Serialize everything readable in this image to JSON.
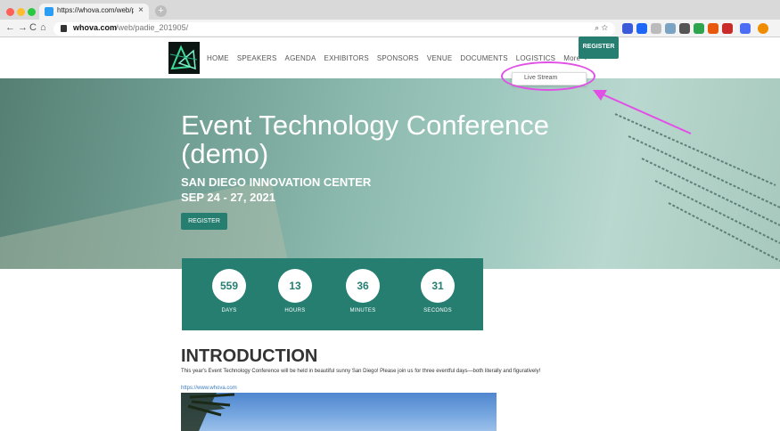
{
  "browser": {
    "tab_title": "https://whova.com/web/padie",
    "tab_close": "×",
    "new_tab": "+",
    "nav_back": "←",
    "nav_forward": "→",
    "nav_reload": "C",
    "nav_home": "⌂",
    "url_host": "whova.com",
    "url_path": "/web/padie_201905/",
    "omni_icons": "⌕ ☆"
  },
  "site": {
    "nav_items": [
      "HOME",
      "SPEAKERS",
      "AGENDA",
      "EXHIBITORS",
      "SPONSORS",
      "VENUE",
      "DOCUMENTS",
      "LOGISTICS"
    ],
    "more_label": "More",
    "register_top": "REGISTER",
    "dropdown_item": "Live Stream"
  },
  "hero": {
    "title": "Event Technology Conference (demo)",
    "venue": "SAN DIEGO INNOVATION CENTER",
    "date": "SEP 24 - 27, 2021",
    "register": "REGISTER"
  },
  "countdown": [
    {
      "value": "559",
      "label": "DAYS"
    },
    {
      "value": "13",
      "label": "HOURS"
    },
    {
      "value": "36",
      "label": "MINUTES"
    },
    {
      "value": "31",
      "label": "SECONDS"
    }
  ],
  "intro": {
    "title": "INTRODUCTION",
    "text": "This year's Event Technology Conference will be held in beautiful sunny San Diego! Please join us for three eventful days—both literally and figuratively!",
    "link": "https://www.whova.com"
  },
  "colors": {
    "accent": "#267e71",
    "annotation": "#e14fe6"
  }
}
